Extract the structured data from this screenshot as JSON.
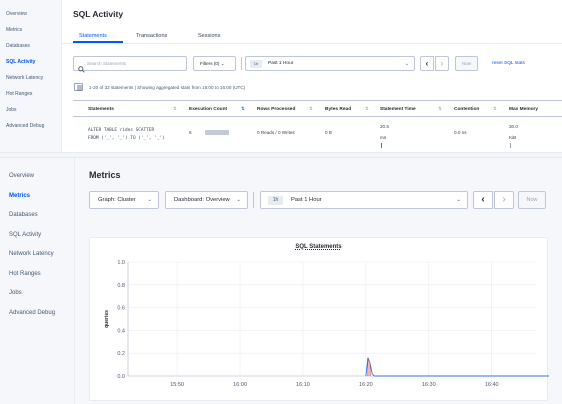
{
  "top": {
    "sidebar": [
      {
        "label": "Overview",
        "active": false
      },
      {
        "label": "Metrics",
        "active": false
      },
      {
        "label": "Databases",
        "active": false
      },
      {
        "label": "SQL Activity",
        "active": true
      },
      {
        "label": "Network Latency",
        "active": false
      },
      {
        "label": "Hot Ranges",
        "active": false
      },
      {
        "label": "Jobs",
        "active": false
      },
      {
        "label": "Advanced Debug",
        "active": false
      }
    ],
    "title": "SQL Activity",
    "tabs": [
      {
        "label": "Statements",
        "active": true
      },
      {
        "label": "Transactions",
        "active": false
      },
      {
        "label": "Sessions",
        "active": false
      }
    ],
    "search_placeholder": "Search Statements",
    "filters_label": "Filters (0)",
    "time_badge": "1h",
    "time_label": "Past 1 Hour",
    "now_label": "Now",
    "reset_label": "reset SQL stats",
    "info_text": "1-20 of 32 statements  |  Showing aggregated stats from 15:00 to 16:00 (UTC)",
    "columns": [
      "Statements",
      "Execution Count",
      "Rows Processed",
      "Bytes Read",
      "Statement Time",
      "Contention",
      "Max Memory"
    ],
    "row": {
      "statement_line1": "ALTER TABLE rides SCATTER",
      "statement_line2": "FROM ('_', '_') TO ('_', '_')",
      "execution_count": "6",
      "rows_processed": "0 Reads / 0 Writes",
      "bytes_read": "0 B",
      "statement_time": "20.5",
      "statement_time_unit": "ms",
      "contention": "0.0 ns",
      "max_memory": "30.0",
      "max_memory_unit": "KiB"
    }
  },
  "bottom": {
    "sidebar": [
      {
        "label": "Overview",
        "active": false
      },
      {
        "label": "Metrics",
        "active": true
      },
      {
        "label": "Databases",
        "active": false
      },
      {
        "label": "SQL Activity",
        "active": false
      },
      {
        "label": "Network Latency",
        "active": false
      },
      {
        "label": "Hot Ranges",
        "active": false
      },
      {
        "label": "Jobs",
        "active": false
      },
      {
        "label": "Advanced Debug",
        "active": false
      }
    ],
    "title": "Metrics",
    "graph_dropdown": "Graph: Cluster",
    "dashboard_dropdown": "Dashboard: Overview",
    "time_badge": "1h",
    "time_label": "Past 1 Hour",
    "now_label": "Now"
  },
  "colors": {
    "accent": "#0055ff",
    "series": "#3a6cf0",
    "spike": "#c0392b"
  },
  "chart_data": {
    "type": "line",
    "title": "SQL Statements",
    "xlabel": "",
    "ylabel": "queries",
    "x_ticks": [
      "15:50",
      "16:00",
      "16:10",
      "16:20",
      "16:30",
      "16:40"
    ],
    "y_ticks": [
      "0.0",
      "0.2",
      "0.4",
      "0.6",
      "0.8",
      "1.0"
    ],
    "ylim": [
      0,
      1.0
    ],
    "grid": true,
    "series": [
      {
        "x": [
          "16:20:00",
          "16:20:20",
          "16:20:40",
          "16:21:00",
          "16:21:20",
          "16:21:40",
          "16:50:00"
        ],
        "values": [
          0.0,
          0.16,
          0.11,
          0.02,
          0.0,
          0.0,
          0.0
        ]
      }
    ]
  }
}
